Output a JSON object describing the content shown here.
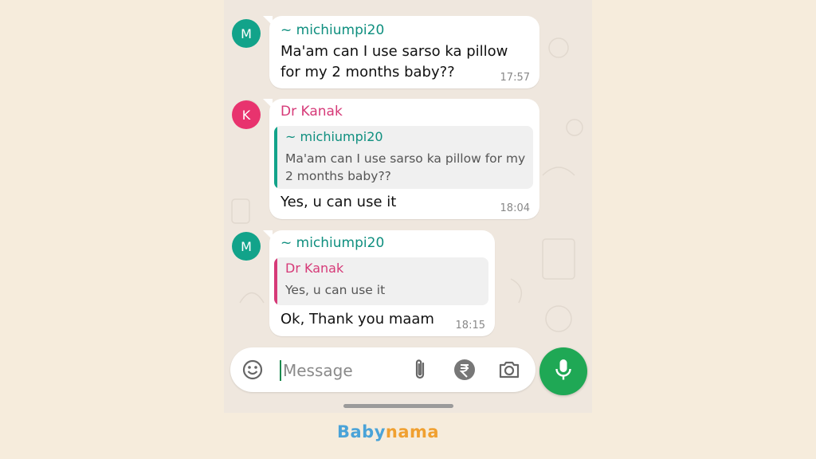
{
  "chat": {
    "messages": [
      {
        "avatar_letter": "M",
        "sender": "~ michiumpi20",
        "text_lines": [
          "Ma'am can I use sarso ka pillow",
          "for my 2 months baby??"
        ],
        "time": "17:57"
      },
      {
        "avatar_letter": "K",
        "sender": "Dr Kanak",
        "quote": {
          "sender": "~ michiumpi20",
          "text_lines": [
            "Ma'am can I use sarso ka pillow for my",
            "2 months baby??"
          ]
        },
        "text": "Yes, u can use it",
        "time": "18:04"
      },
      {
        "avatar_letter": "M",
        "sender": "~ michiumpi20",
        "quote": {
          "sender": "Dr Kanak",
          "text": "Yes, u can use it"
        },
        "text": "Ok, Thank you maam",
        "time": "18:15"
      }
    ]
  },
  "composer": {
    "placeholder": "Message",
    "icons": [
      "emoji-icon",
      "attach-icon",
      "rupee-icon",
      "camera-icon",
      "mic-icon"
    ]
  },
  "brand": {
    "part1": "Baby",
    "part2": "nama"
  },
  "colors": {
    "page_bg": "#f6ecdc",
    "chat_bg": "#efe7de",
    "teal_avatar": "#12a38a",
    "pink_avatar": "#e8336e",
    "teal_name": "#0f8f7f",
    "pink_name": "#d63a78",
    "mic_green": "#1fa855",
    "brand_blue": "#4aa3d8",
    "brand_orange": "#f0a030"
  }
}
